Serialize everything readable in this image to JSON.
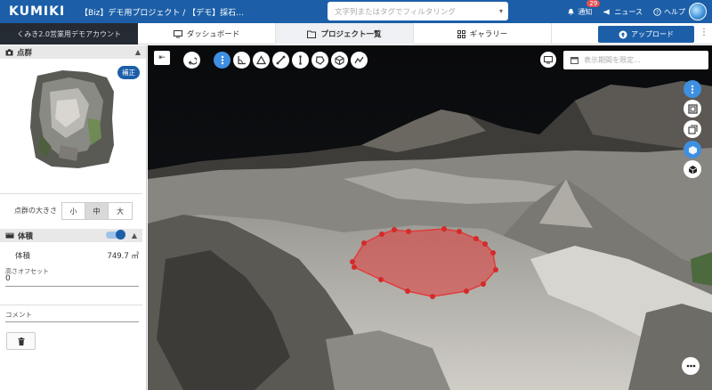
{
  "header": {
    "logo": "KUMIKI",
    "breadcrumb": "【Biz】デモ用プロジェクト / 【デモ】採石…",
    "search_placeholder": "文字列またはタグでフィルタリング",
    "notifications_label": "通知",
    "notifications_count": "29",
    "news_label": "ニュース",
    "help_label": "ヘルプ"
  },
  "subbar": {
    "account": "くみき2.0営業用デモアカウント",
    "tabs": [
      {
        "label": "ダッシュボード",
        "icon": "monitor-icon"
      },
      {
        "label": "プロジェクト一覧",
        "icon": "folder-icon"
      },
      {
        "label": "ギャラリー",
        "icon": "grid-icon"
      }
    ],
    "upload_label": "アップロード"
  },
  "sidebar": {
    "pointcloud_title": "点群",
    "correction_badge": "補正",
    "point_size_label": "点群の大きさ",
    "point_size_options": [
      "小",
      "中",
      "大"
    ],
    "point_size_selected": "中",
    "volume_title": "体積",
    "volume_label": "体積",
    "volume_value": "749.7 ㎥",
    "volume_toggle_on": true,
    "height_offset_label": "高さオフセット",
    "height_offset_value": "0",
    "comment_label": "コメント"
  },
  "viewer": {
    "period_placeholder": "表示期間を限定...",
    "colors": {
      "polygon": "#e23c3c",
      "accent": "#3f8fe0"
    }
  }
}
